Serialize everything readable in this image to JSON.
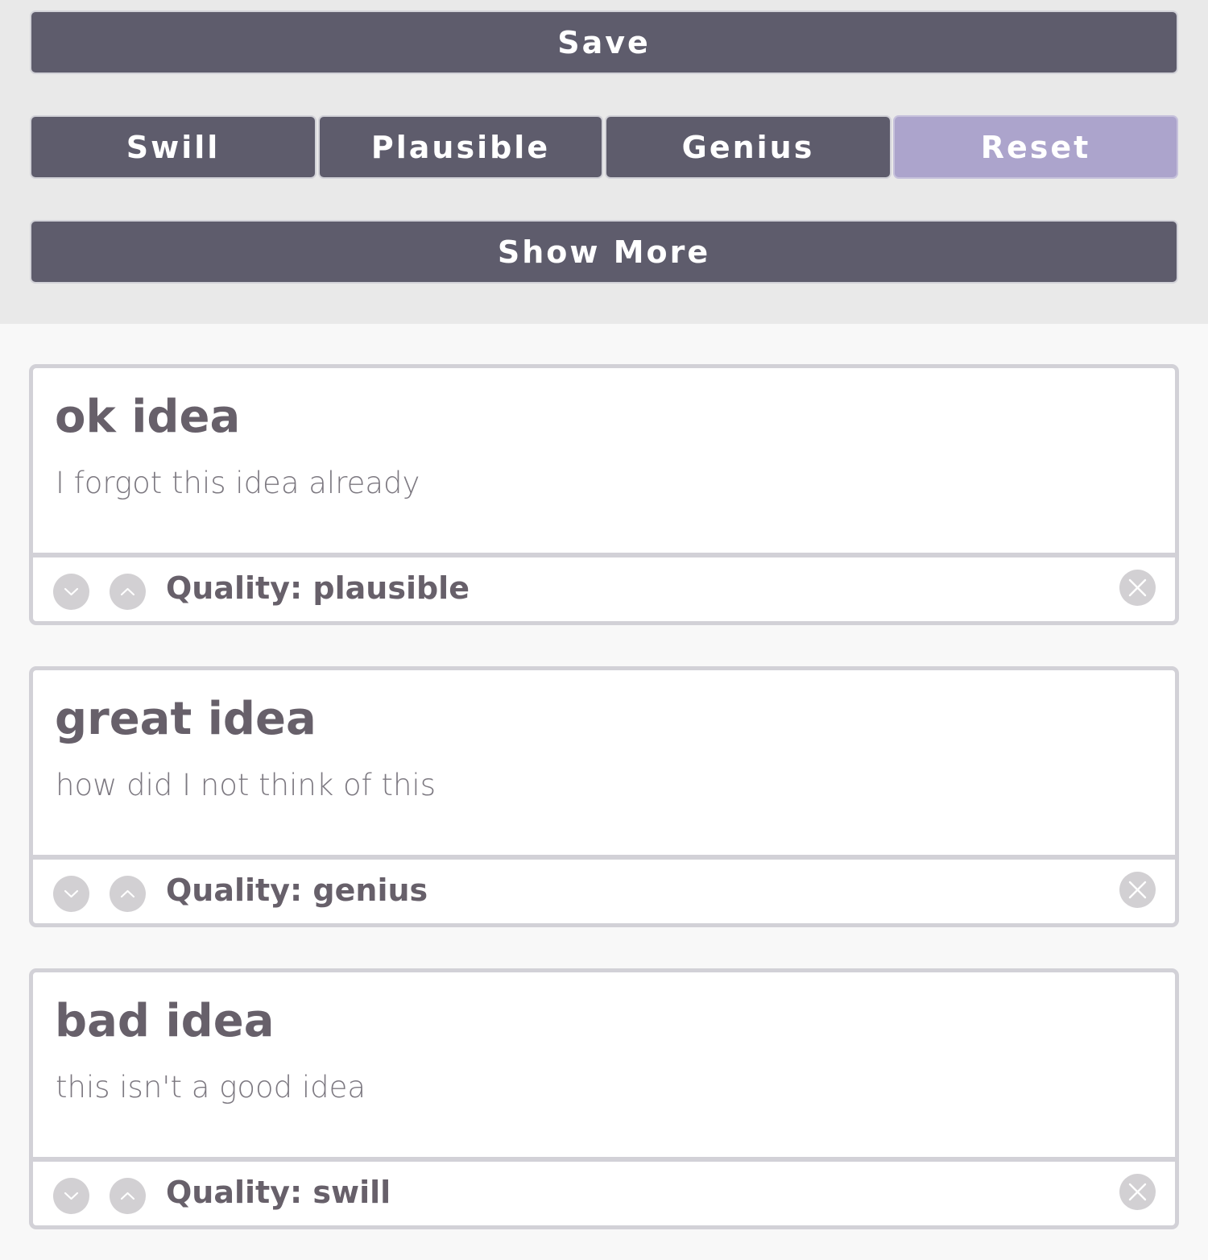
{
  "toolbar": {
    "save_label": "Save",
    "filters": [
      {
        "label": "Swill"
      },
      {
        "label": "Plausible"
      },
      {
        "label": "Genius"
      }
    ],
    "reset_label": "Reset",
    "show_more_label": "Show More"
  },
  "colors": {
    "button": "#5e5c6c",
    "reset_button": "#aca4cc",
    "card_border": "#d2d1d7",
    "text": "#67606a"
  },
  "ideas": [
    {
      "title": "ok idea",
      "description": "I forgot this idea already",
      "quality": "Quality: plausible"
    },
    {
      "title": "great idea",
      "description": "how did I not think of this",
      "quality": "Quality: genius"
    },
    {
      "title": "bad idea",
      "description": "this isn't a good idea",
      "quality": "Quality: swill"
    }
  ],
  "icons": {
    "down": "chevron-down-icon",
    "up": "chevron-up-icon",
    "close": "close-icon"
  }
}
